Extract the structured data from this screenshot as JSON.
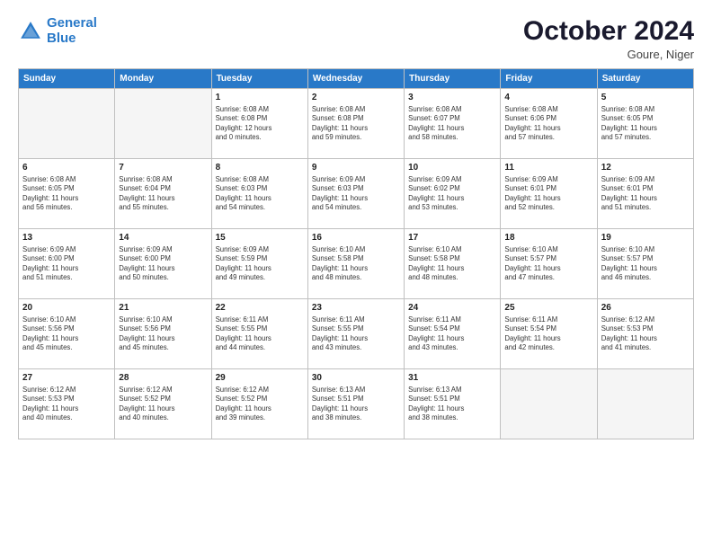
{
  "header": {
    "logo_line1": "General",
    "logo_line2": "Blue",
    "month_title": "October 2024",
    "subtitle": "Goure, Niger"
  },
  "weekdays": [
    "Sunday",
    "Monday",
    "Tuesday",
    "Wednesday",
    "Thursday",
    "Friday",
    "Saturday"
  ],
  "weeks": [
    [
      {
        "num": "",
        "info": ""
      },
      {
        "num": "",
        "info": ""
      },
      {
        "num": "1",
        "info": "Sunrise: 6:08 AM\nSunset: 6:08 PM\nDaylight: 12 hours\nand 0 minutes."
      },
      {
        "num": "2",
        "info": "Sunrise: 6:08 AM\nSunset: 6:08 PM\nDaylight: 11 hours\nand 59 minutes."
      },
      {
        "num": "3",
        "info": "Sunrise: 6:08 AM\nSunset: 6:07 PM\nDaylight: 11 hours\nand 58 minutes."
      },
      {
        "num": "4",
        "info": "Sunrise: 6:08 AM\nSunset: 6:06 PM\nDaylight: 11 hours\nand 57 minutes."
      },
      {
        "num": "5",
        "info": "Sunrise: 6:08 AM\nSunset: 6:05 PM\nDaylight: 11 hours\nand 57 minutes."
      }
    ],
    [
      {
        "num": "6",
        "info": "Sunrise: 6:08 AM\nSunset: 6:05 PM\nDaylight: 11 hours\nand 56 minutes."
      },
      {
        "num": "7",
        "info": "Sunrise: 6:08 AM\nSunset: 6:04 PM\nDaylight: 11 hours\nand 55 minutes."
      },
      {
        "num": "8",
        "info": "Sunrise: 6:08 AM\nSunset: 6:03 PM\nDaylight: 11 hours\nand 54 minutes."
      },
      {
        "num": "9",
        "info": "Sunrise: 6:09 AM\nSunset: 6:03 PM\nDaylight: 11 hours\nand 54 minutes."
      },
      {
        "num": "10",
        "info": "Sunrise: 6:09 AM\nSunset: 6:02 PM\nDaylight: 11 hours\nand 53 minutes."
      },
      {
        "num": "11",
        "info": "Sunrise: 6:09 AM\nSunset: 6:01 PM\nDaylight: 11 hours\nand 52 minutes."
      },
      {
        "num": "12",
        "info": "Sunrise: 6:09 AM\nSunset: 6:01 PM\nDaylight: 11 hours\nand 51 minutes."
      }
    ],
    [
      {
        "num": "13",
        "info": "Sunrise: 6:09 AM\nSunset: 6:00 PM\nDaylight: 11 hours\nand 51 minutes."
      },
      {
        "num": "14",
        "info": "Sunrise: 6:09 AM\nSunset: 6:00 PM\nDaylight: 11 hours\nand 50 minutes."
      },
      {
        "num": "15",
        "info": "Sunrise: 6:09 AM\nSunset: 5:59 PM\nDaylight: 11 hours\nand 49 minutes."
      },
      {
        "num": "16",
        "info": "Sunrise: 6:10 AM\nSunset: 5:58 PM\nDaylight: 11 hours\nand 48 minutes."
      },
      {
        "num": "17",
        "info": "Sunrise: 6:10 AM\nSunset: 5:58 PM\nDaylight: 11 hours\nand 48 minutes."
      },
      {
        "num": "18",
        "info": "Sunrise: 6:10 AM\nSunset: 5:57 PM\nDaylight: 11 hours\nand 47 minutes."
      },
      {
        "num": "19",
        "info": "Sunrise: 6:10 AM\nSunset: 5:57 PM\nDaylight: 11 hours\nand 46 minutes."
      }
    ],
    [
      {
        "num": "20",
        "info": "Sunrise: 6:10 AM\nSunset: 5:56 PM\nDaylight: 11 hours\nand 45 minutes."
      },
      {
        "num": "21",
        "info": "Sunrise: 6:10 AM\nSunset: 5:56 PM\nDaylight: 11 hours\nand 45 minutes."
      },
      {
        "num": "22",
        "info": "Sunrise: 6:11 AM\nSunset: 5:55 PM\nDaylight: 11 hours\nand 44 minutes."
      },
      {
        "num": "23",
        "info": "Sunrise: 6:11 AM\nSunset: 5:55 PM\nDaylight: 11 hours\nand 43 minutes."
      },
      {
        "num": "24",
        "info": "Sunrise: 6:11 AM\nSunset: 5:54 PM\nDaylight: 11 hours\nand 43 minutes."
      },
      {
        "num": "25",
        "info": "Sunrise: 6:11 AM\nSunset: 5:54 PM\nDaylight: 11 hours\nand 42 minutes."
      },
      {
        "num": "26",
        "info": "Sunrise: 6:12 AM\nSunset: 5:53 PM\nDaylight: 11 hours\nand 41 minutes."
      }
    ],
    [
      {
        "num": "27",
        "info": "Sunrise: 6:12 AM\nSunset: 5:53 PM\nDaylight: 11 hours\nand 40 minutes."
      },
      {
        "num": "28",
        "info": "Sunrise: 6:12 AM\nSunset: 5:52 PM\nDaylight: 11 hours\nand 40 minutes."
      },
      {
        "num": "29",
        "info": "Sunrise: 6:12 AM\nSunset: 5:52 PM\nDaylight: 11 hours\nand 39 minutes."
      },
      {
        "num": "30",
        "info": "Sunrise: 6:13 AM\nSunset: 5:51 PM\nDaylight: 11 hours\nand 38 minutes."
      },
      {
        "num": "31",
        "info": "Sunrise: 6:13 AM\nSunset: 5:51 PM\nDaylight: 11 hours\nand 38 minutes."
      },
      {
        "num": "",
        "info": ""
      },
      {
        "num": "",
        "info": ""
      }
    ]
  ]
}
